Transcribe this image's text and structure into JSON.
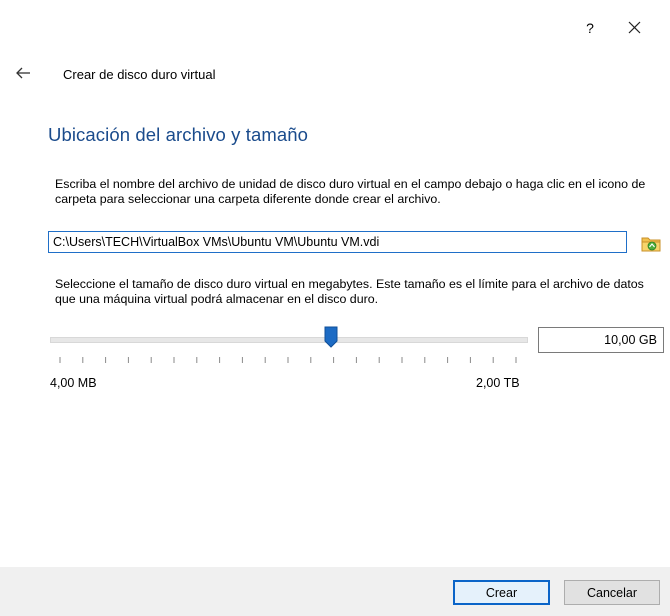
{
  "window": {
    "help_label": "?",
    "close_icon": "close-icon"
  },
  "wizard": {
    "back_icon": "back-arrow-icon",
    "title": "Crear de disco duro virtual"
  },
  "page": {
    "heading": "Ubicación del archivo y tamaño",
    "file_instructions": "Escriba el nombre del archivo de unidad de disco duro virtual en el campo debajo o haga clic en el icono de carpeta para seleccionar una carpeta diferente donde crear el archivo.",
    "file_path": "C:\\Users\\TECH\\VirtualBox VMs\\Ubuntu VM\\Ubuntu VM.vdi",
    "folder_icon": "folder-icon",
    "size_instructions": "Seleccione el tamaño de disco duro virtual en megabytes. Este tamaño es el límite para el archivo de datos que una máquina virtual podrá almacenar en el disco duro.",
    "size_value": "10,00 GB",
    "size_min_label": "4,00 MB",
    "size_max_label": "2,00 TB",
    "slider_position_fraction": 0.59,
    "slider_tick_count": 21
  },
  "footer": {
    "create_label": "Crear",
    "cancel_label": "Cancelar"
  },
  "colors": {
    "heading": "#1a4b8c",
    "accent": "#1f6fc8",
    "slider_handle": "#1c6bc4",
    "footer_bg": "#f0f0f0"
  }
}
